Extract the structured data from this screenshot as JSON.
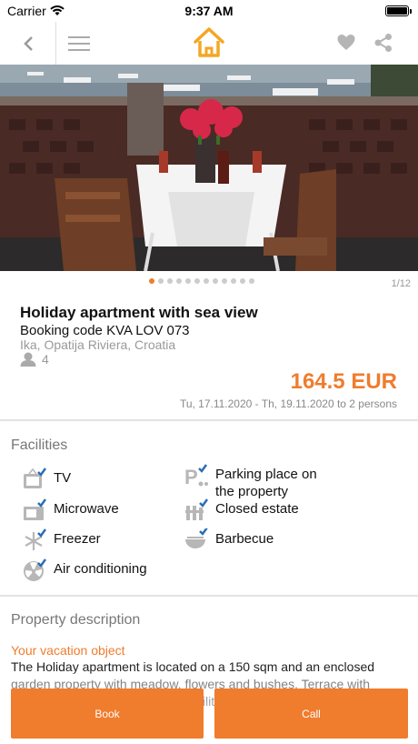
{
  "status_bar": {
    "carrier": "Carrier",
    "time": "9:37 AM"
  },
  "nav": {
    "back_icon": "chevron-left-icon",
    "menu_icon": "hamburger-icon",
    "logo_icon": "house-logo-icon",
    "favorite_icon": "heart-icon",
    "share_icon": "share-icon"
  },
  "carousel": {
    "total_dots": 12,
    "active_index": 0,
    "counter": "1/12"
  },
  "property": {
    "title": "Holiday apartment with sea view",
    "booking_code": "Booking code KVA LOV 073",
    "location": "Ika, Opatija Riviera, Croatia",
    "persons": "4",
    "price": "164.5 EUR",
    "dates": "Tu, 17.11.2020 - Th, 19.11.2020 to 2 persons"
  },
  "facilities": {
    "title": "Facilities",
    "items": [
      {
        "label": "TV",
        "icon": "tv-icon"
      },
      {
        "label": "Parking place on the property",
        "icon": "parking-icon"
      },
      {
        "label": "Microwave",
        "icon": "microwave-icon"
      },
      {
        "label": "Closed estate",
        "icon": "fence-icon"
      },
      {
        "label": "Freezer",
        "icon": "snowflake-icon"
      },
      {
        "label": "Barbecue",
        "icon": "barbecue-icon"
      },
      {
        "label": "Air conditioning",
        "icon": "fan-icon"
      }
    ]
  },
  "description": {
    "title": "Property description",
    "subtitle": "Your vacation object",
    "text": "The Holiday apartment is located on a 150 sqm and an enclosed garden property with meadow, flowers and bushes. Terrace with garden furniture. Barbecue possibilities, are available"
  },
  "actions": {
    "book": "Book",
    "call": "Call"
  },
  "colors": {
    "accent": "#f07c2d",
    "check": "#2a6db5",
    "icon_gray": "#b7b7b7"
  }
}
